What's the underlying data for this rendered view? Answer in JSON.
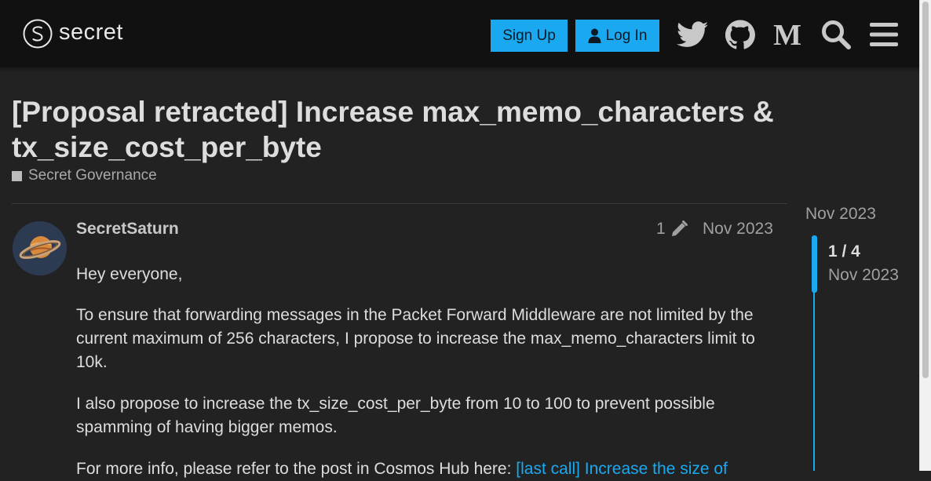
{
  "header": {
    "logo_text": "secret",
    "signup_label": "Sign Up",
    "login_label": "Log In",
    "icons": [
      "twitter-icon",
      "github-icon",
      "medium-icon",
      "search-icon",
      "menu-icon"
    ]
  },
  "topic": {
    "title": "[Proposal retracted] Increase max_memo_characters & tx_size_cost_per_byte",
    "category": "Secret Governance"
  },
  "post": {
    "username": "SecretSaturn",
    "edit_count": "1",
    "date": "Nov 2023",
    "paragraphs": [
      "Hey everyone,",
      "To ensure that forwarding messages in the Packet Forward Middleware are not limited by the current maximum of 256 characters, I propose to increase the max_memo_characters limit to 10k.",
      "I also propose to increase the tx_size_cost_per_byte from 10 to 100 to prevent possible spamming of having bigger memos."
    ],
    "p4_prefix": "For more info, please refer to the post in Cosmos Hub here: ",
    "p4_link": "[last call] Increase the size of"
  },
  "timeline": {
    "top_date": "Nov 2023",
    "position": "1 / 4",
    "current_date": "Nov 2023"
  },
  "colors": {
    "accent": "#1aa9f0",
    "background": "#222222",
    "header": "#111111"
  }
}
